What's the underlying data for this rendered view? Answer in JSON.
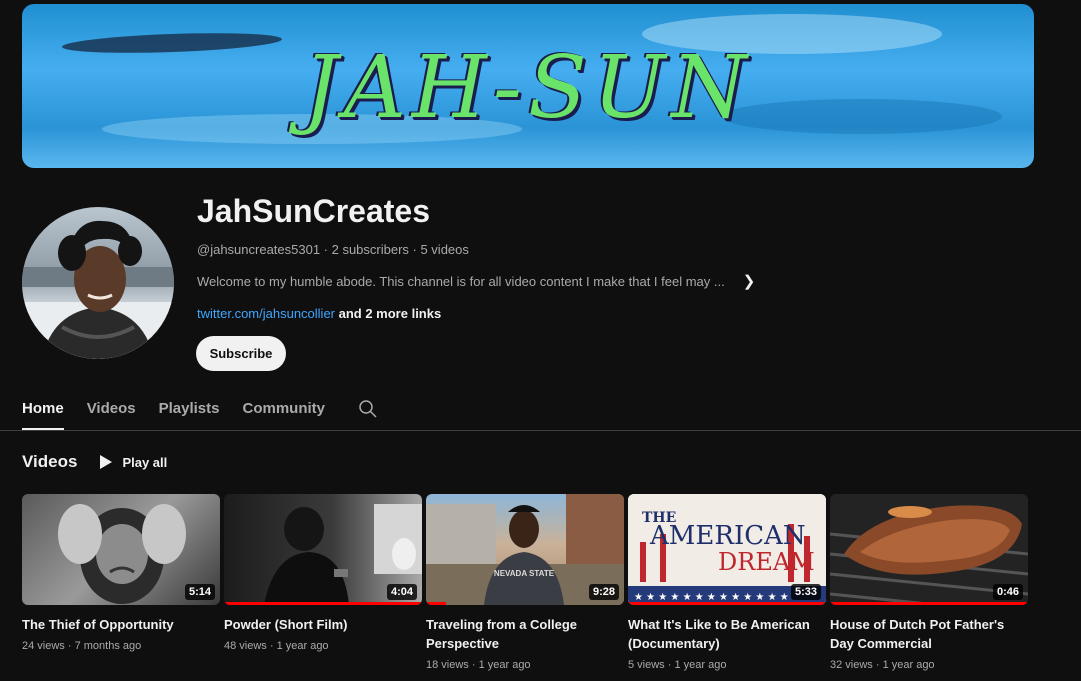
{
  "banner": {
    "text": "JAH-SUN"
  },
  "channel": {
    "name": "JahSunCreates",
    "meta": "@jahsuncreates5301 · 2 subscribers · 5 videos",
    "description": "Welcome to my humble abode. This channel is for all video content I make that I feel may ...",
    "link": "twitter.com/jahsuncollier",
    "more_links": " and 2 more links",
    "subscribe_label": "Subscribe"
  },
  "tabs": [
    {
      "label": "Home",
      "active": true
    },
    {
      "label": "Videos"
    },
    {
      "label": "Playlists"
    },
    {
      "label": "Community"
    }
  ],
  "section": {
    "title": "Videos",
    "play_all": "Play all"
  },
  "videos": [
    {
      "title": "The Thief of Opportunity",
      "meta": "24 views · 7 months ago",
      "duration": "5:14",
      "watched_fraction": 0
    },
    {
      "title": "Powder (Short Film)",
      "meta": "48 views · 1 year ago",
      "duration": "4:04",
      "watched_fraction": 1
    },
    {
      "title": "Traveling from a College Perspective",
      "meta": "18 views · 1 year ago",
      "duration": "9:28",
      "watched_fraction": 0.1
    },
    {
      "title": "What It's Like to Be American (Documentary)",
      "meta": "5 views · 1 year ago",
      "duration": "5:33",
      "watched_fraction": 1
    },
    {
      "title": "House of Dutch Pot Father's Day Commercial",
      "meta": "32 views · 1 year ago",
      "duration": "0:46",
      "watched_fraction": 1
    }
  ],
  "thumbnail_texts": {
    "american_dream_line1": "THE",
    "american_dream_line2": "AMERICAN",
    "american_dream_line3": "DREAM",
    "shirt": "NEVADA STATE"
  },
  "colors": {
    "link": "#3ea6ff",
    "progress": "#ff0000",
    "banner_text": "#6ae36a"
  }
}
